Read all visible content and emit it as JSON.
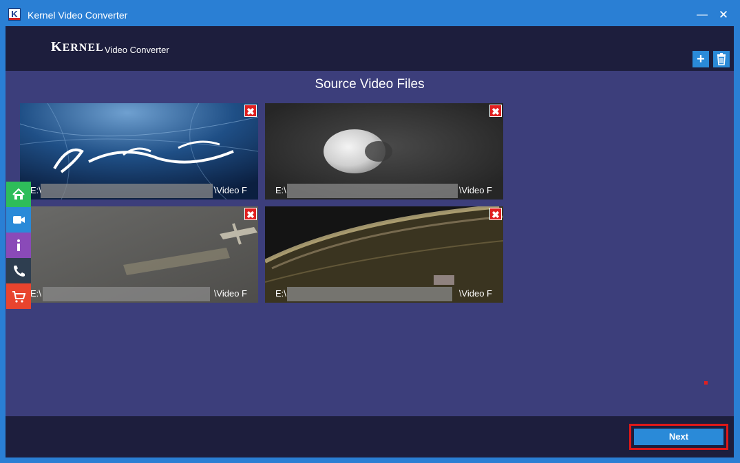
{
  "window": {
    "title": "Kernel Video Converter",
    "app_icon_letter": "K",
    "minimize_glyph": "—",
    "close_glyph": "✕"
  },
  "header": {
    "logo_first_letter": "K",
    "logo_rest": "ERNEL",
    "product_name": "Video Converter",
    "add_glyph": "+",
    "delete_icon": "trash-icon"
  },
  "section_title": "Source Video Files",
  "tiles": [
    {
      "path_prefix": "E:\\",
      "path_suffix": "\\Video F",
      "remove_glyph": "✖"
    },
    {
      "path_prefix": "E:\\",
      "path_suffix": "\\Video F",
      "remove_glyph": "✖"
    },
    {
      "path_prefix": "E:\\",
      "path_suffix": "\\Video F",
      "remove_glyph": "✖"
    },
    {
      "path_prefix": "E:\\",
      "path_suffix": "\\Video F",
      "remove_glyph": "✖"
    }
  ],
  "side_nav": [
    {
      "icon": "home-icon",
      "color": "#2ebd5a"
    },
    {
      "icon": "video-camera-icon",
      "color": "#2a8ad8"
    },
    {
      "icon": "info-icon",
      "color": "#8a4ab8"
    },
    {
      "icon": "phone-icon",
      "color": "#2e3e50"
    },
    {
      "icon": "cart-icon",
      "color": "#e8442e"
    }
  ],
  "footer": {
    "next_label": "Next"
  },
  "colors": {
    "titlebar": "#2a7fd4",
    "body": "#3c3e7b",
    "header_footer": "#1d1e3d",
    "accent": "#2a8ad8",
    "highlight_border": "#e01818"
  }
}
